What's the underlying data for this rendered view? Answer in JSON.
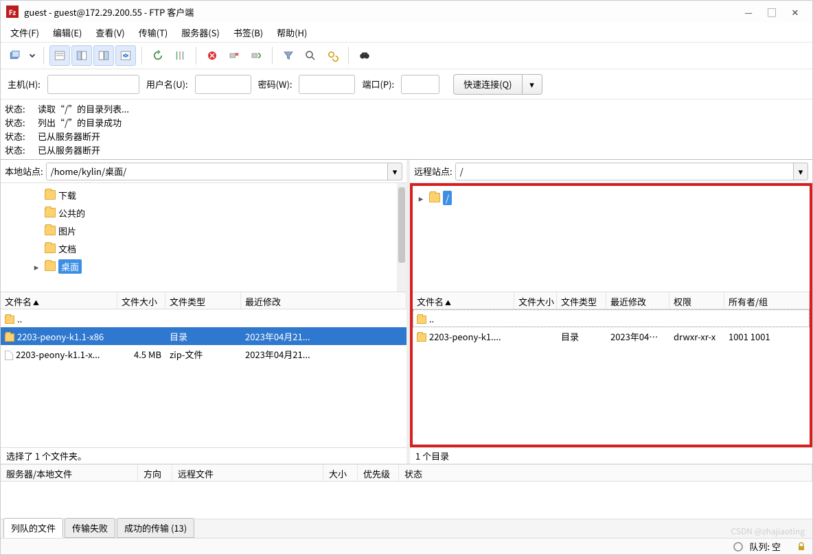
{
  "titlebar": {
    "title": "guest - guest@172.29.200.55 - FTP 客户端"
  },
  "menu": {
    "file": "文件(F)",
    "edit": "编辑(E)",
    "view": "查看(V)",
    "transfer": "传输(T)",
    "server": "服务器(S)",
    "bookmarks": "书签(B)",
    "help": "帮助(H)"
  },
  "connect": {
    "host_label": "主机(H):",
    "user_label": "用户名(U):",
    "pass_label": "密码(W):",
    "port_label": "端口(P):",
    "button": "快速连接(Q)",
    "host": "",
    "user": "",
    "pass": "",
    "port": ""
  },
  "log": {
    "status_label": "状态:",
    "lines": [
      "读取“/”的目录列表...",
      "列出“/”的目录成功",
      "已从服务器断开",
      "已从服务器断开"
    ]
  },
  "local": {
    "path_label": "本地站点:",
    "path": "/home/kylin/桌面/",
    "tree": [
      "下载",
      "公共的",
      "图片",
      "文档",
      "桌面"
    ],
    "tree_selected": "桌面",
    "cols": {
      "name": "文件名",
      "size": "文件大小",
      "type": "文件类型",
      "modified": "最近修改"
    },
    "rows": [
      {
        "name": "..",
        "size": "",
        "type": "",
        "modified": "",
        "icon": "folder"
      },
      {
        "name": "2203-peony-k1.1-x86",
        "size": "",
        "type": "目录",
        "modified": "2023年04月21...",
        "icon": "folder",
        "selected": true
      },
      {
        "name": "2203-peony-k1.1-x...",
        "size": "4.5 MB",
        "type": "zip-文件",
        "modified": "2023年04月21...",
        "icon": "file"
      }
    ],
    "status": "选择了 1 个文件夹。"
  },
  "remote": {
    "path_label": "远程站点:",
    "path": "/",
    "tree_root": "/",
    "cols": {
      "name": "文件名",
      "size": "文件大小",
      "type": "文件类型",
      "modified": "最近修改",
      "perm": "权限",
      "owner": "所有者/组"
    },
    "rows": [
      {
        "name": "..",
        "size": "",
        "type": "",
        "modified": "",
        "perm": "",
        "owner": "",
        "icon": "folder",
        "dotted": true
      },
      {
        "name": "2203-peony-k1....",
        "size": "",
        "type": "目录",
        "modified": "2023年04月...",
        "perm": "drwxr-xr-x",
        "owner": "1001 1001",
        "icon": "folder"
      }
    ],
    "status": "1 个目录"
  },
  "queue": {
    "cols": {
      "serverfile": "服务器/本地文件",
      "dir": "方向",
      "remotefile": "远程文件",
      "size": "大小",
      "priority": "优先级",
      "status": "状态"
    }
  },
  "tabs": {
    "queued": "列队的文件",
    "failed": "传输失败",
    "success": "成功的传输 (13)"
  },
  "footer": {
    "queue": "队列: 空"
  },
  "watermark": "CSDN @zhajiaoting"
}
